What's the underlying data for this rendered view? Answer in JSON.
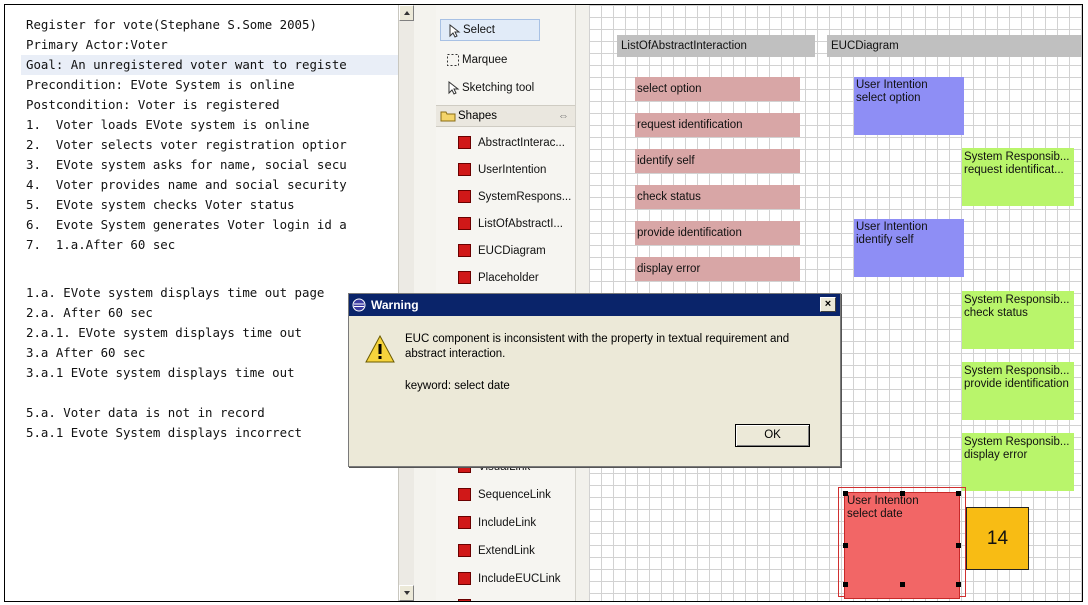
{
  "editor": {
    "lines": [
      "Register for vote(Stephane S.Some 2005)",
      "Primary Actor:Voter",
      "Goal: An unregistered voter want to registe",
      "Precondition: EVote System is online",
      "Postcondition: Voter is registered",
      "1.  Voter loads EVote system is online",
      "2.  Voter selects voter registration optior",
      "3.  EVote system asks for name, social secu",
      "4.  Voter provides name and social security",
      "5.  EVote system checks Voter status",
      "6.  Evote System generates Voter login id a",
      "7.  1.a.After 60 sec",
      "",
      "1.a. EVote system displays time out page",
      "2.a. After 60 sec",
      "2.a.1. EVote system displays time out",
      "3.a After 60 sec",
      "3.a.1 EVote system displays time out",
      "",
      "5.a. Voter data is not in record",
      "5.a.1 Evote System displays incorrect"
    ]
  },
  "palette": {
    "tools": [
      "Select",
      "Marquee",
      "Sketching tool"
    ],
    "drawer_label": "Shapes",
    "shapes": [
      "AbstractInterac...",
      "UserIntention",
      "SystemRespons...",
      "ListOfAbstractI...",
      "EUCDiagram",
      "Placeholder",
      "VisualLink",
      "SequenceLink",
      "IncludeLink",
      "ExtendLink",
      "IncludeEUCLink"
    ]
  },
  "canvas": {
    "col_list": "ListOfAbstractInteraction",
    "col_euc": "EUCDiagram",
    "abstract_items": [
      "select option",
      "request identification",
      "identify self",
      "check status",
      "provide identification",
      "display error"
    ],
    "user_intentions": [
      {
        "title": "User Intention",
        "text": "select option"
      },
      {
        "title": "User Intention",
        "text": "identify self"
      }
    ],
    "system_responsibilities": [
      {
        "title": "System Responsib...",
        "text": "request identificat..."
      },
      {
        "title": "System Responsib...",
        "text": "check status"
      },
      {
        "title": "System Responsib...",
        "text": "provide identification"
      },
      {
        "title": "System Responsib...",
        "text": "display error"
      }
    ],
    "selected": {
      "title": "User Intention",
      "text": "select date"
    },
    "badge": "14"
  },
  "dialog": {
    "title": "Warning",
    "message": "EUC component is inconsistent with the property in textual requirement and abstract interaction.",
    "keyword": "keyword: select date",
    "ok": "OK",
    "close": "×"
  },
  "colors": {
    "abstract": "#d8a6a6",
    "user_intention": "#8e8ef5",
    "system_responsibility": "#b9f56b",
    "selected": "#f26666",
    "badge": "#f8bc14",
    "titlebar": "#0a246a"
  }
}
